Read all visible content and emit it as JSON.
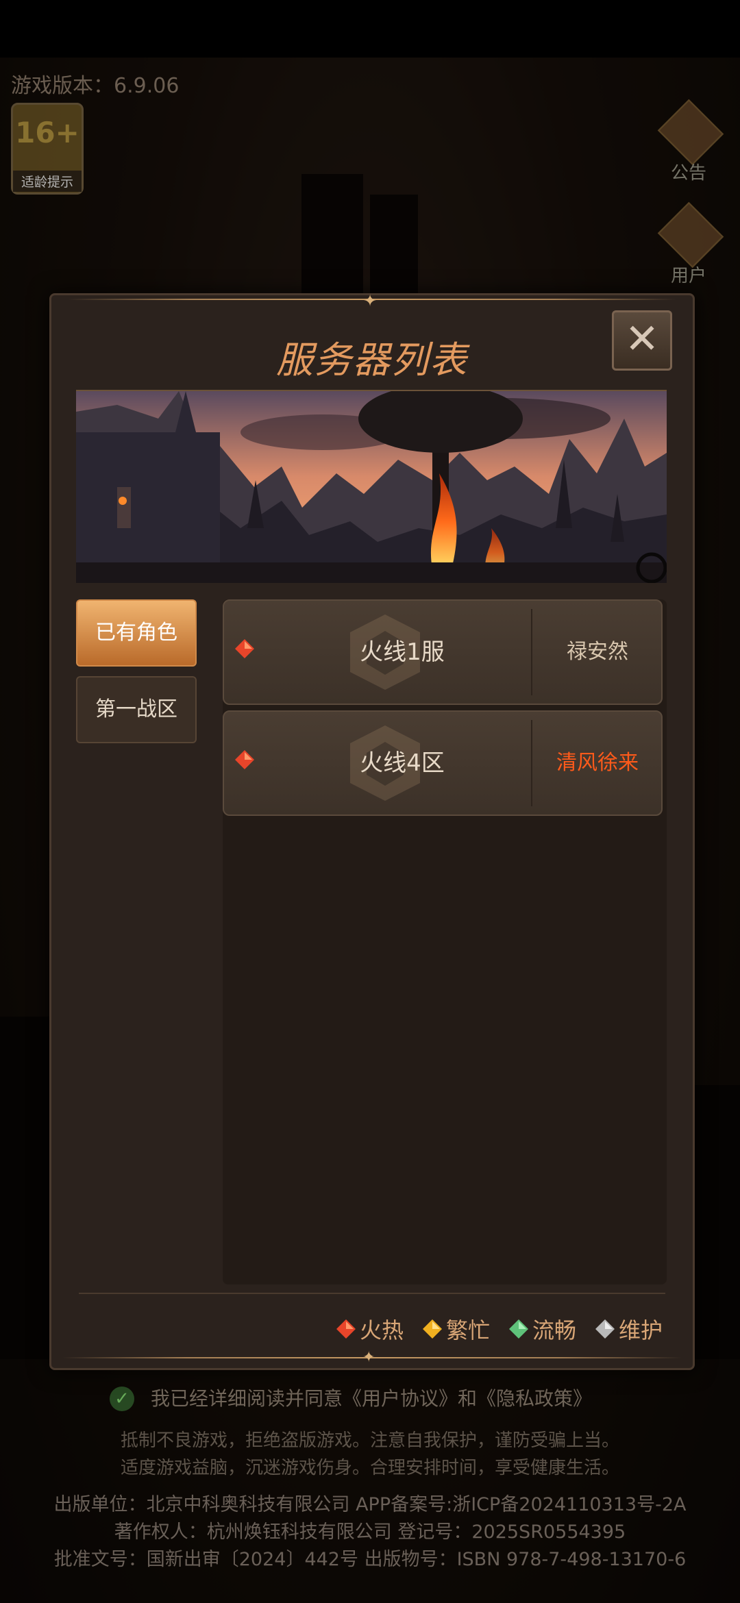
{
  "background": {
    "version_label": "游戏版本：6.9.06",
    "age_rating": {
      "number": "16+",
      "label": "适龄提示"
    },
    "side_buttons": [
      {
        "label": "公告",
        "icon": "horn-icon"
      },
      {
        "label": "用户",
        "icon": "id-card-icon"
      }
    ],
    "consent": {
      "text": "我已经详细阅读并同意《用户协议》和《隐私政策》"
    },
    "notice": [
      "抵制不良游戏，拒绝盗版游戏。注意自我保护，谨防受骗上当。",
      "适度游戏益脑，沉迷游戏伤身。合理安排时间，享受健康生活。"
    ],
    "footer": [
      "出版单位：北京中科奥科技有限公司  APP备案号:浙ICP备2024110313号-2A",
      "著作权人：杭州焕钰科技有限公司  登记号：2025SR0554395",
      "批准文号：国新出审〔2024〕442号  出版物号：ISBN 978-7-498-13170-6"
    ]
  },
  "dialog": {
    "title": "服务器列表",
    "close_label": "✕",
    "tabs": [
      {
        "label": "已有角色",
        "active": true
      },
      {
        "label": "第一战区",
        "active": false
      }
    ],
    "servers": [
      {
        "name": "火线1服",
        "status": "hot",
        "role": "禄安然",
        "role_highlight": false
      },
      {
        "name": "火线4区",
        "status": "hot",
        "role": "清风徐来",
        "role_highlight": true
      }
    ],
    "legend": [
      {
        "label": "火热",
        "color": "#e8452a"
      },
      {
        "label": "繁忙",
        "color": "#f0b020"
      },
      {
        "label": "流畅",
        "color": "#5fc27a"
      },
      {
        "label": "维护",
        "color": "#b9b9b9"
      }
    ]
  }
}
